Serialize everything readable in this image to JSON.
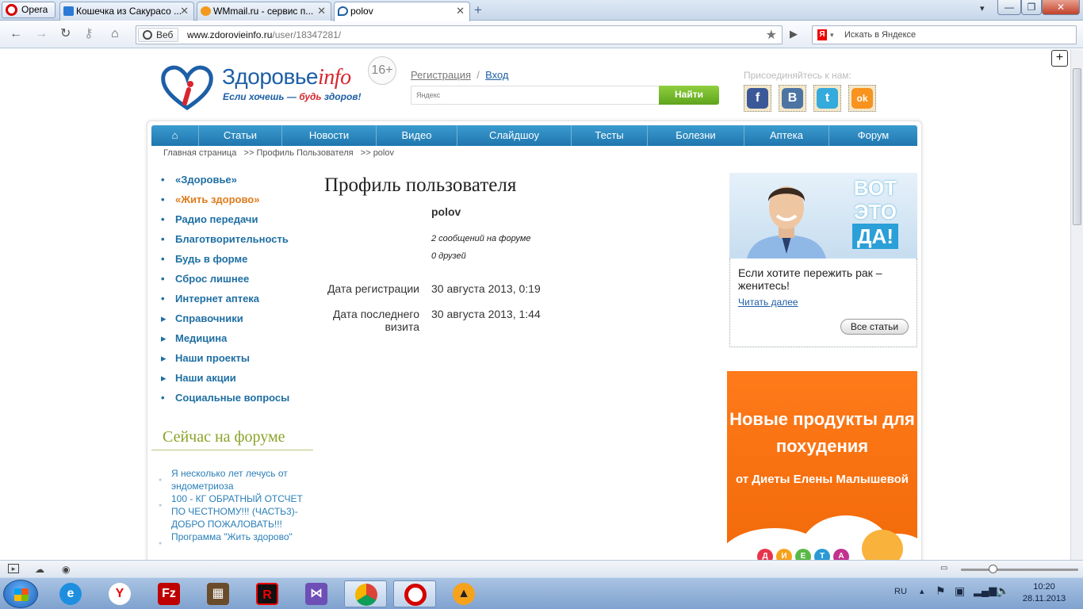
{
  "browser": {
    "menu_label": "Opera",
    "tabs": [
      {
        "title": "Кошечка из Сакурасо ..."
      },
      {
        "title": "WMmail.ru - сервис п..."
      },
      {
        "title": "polov"
      }
    ],
    "web_label": "Веб",
    "url_domain": "www.zdorovieinfo.ru",
    "url_path": "/user/18347281/",
    "search_placeholder": "Искать в Яндексе",
    "search_engine_letter": "Я"
  },
  "site": {
    "logo_main": "Здоровье",
    "logo_accent": "info",
    "slogan_a": "Если хочешь — ",
    "slogan_b": "будь",
    "slogan_c": " здоров!",
    "age": "16+",
    "register": "Регистрация",
    "sep": "/",
    "login": "Вход",
    "search_hint": "Яндекс",
    "search_button": "Найти",
    "join_label": "Присоединяйтесь к нам:",
    "social": [
      {
        "name": "facebook",
        "glyph": "f",
        "color": "#3b5998"
      },
      {
        "name": "vkontakte",
        "glyph": "B",
        "color": "#4c75a3"
      },
      {
        "name": "twitter",
        "glyph": "t",
        "color": "#35aadc"
      },
      {
        "name": "odnoklassniki",
        "glyph": "ok",
        "color": "#f7931e"
      }
    ]
  },
  "menu": {
    "home_glyph": "⌂",
    "items": [
      "Статьи",
      "Новости",
      "Видео",
      "Слайдшоу",
      "Тесты",
      "Болезни",
      "Аптека",
      "Форум"
    ]
  },
  "breadcrumb": {
    "home": "Главная страница",
    "sep": ">>",
    "section": "Профиль Пользователя",
    "current": "polov"
  },
  "leftnav": [
    {
      "label": "«Здоровье»",
      "bullet": "•",
      "orange": false
    },
    {
      "label": "«Жить здорово»",
      "bullet": "•",
      "orange": true
    },
    {
      "label": "Радио передачи",
      "bullet": "•",
      "orange": false
    },
    {
      "label": "Благотворительность",
      "bullet": "•",
      "orange": false
    },
    {
      "label": "Будь в форме",
      "bullet": "•",
      "orange": false
    },
    {
      "label": "Сброс лишнее",
      "bullet": "•",
      "orange": false
    },
    {
      "label": "Интернет аптека",
      "bullet": "•",
      "orange": false
    },
    {
      "label": "Справочники",
      "bullet": "▸",
      "orange": false
    },
    {
      "label": "Медицина",
      "bullet": "▸",
      "orange": false
    },
    {
      "label": "Наши проекты",
      "bullet": "▸",
      "orange": false
    },
    {
      "label": "Наши акции",
      "bullet": "▸",
      "orange": false
    },
    {
      "label": "Социальные вопросы",
      "bullet": "•",
      "orange": false
    }
  ],
  "forum": {
    "title": "Сейчас на форуме",
    "items": [
      "Я несколько лет лечусь от эндометриоза",
      "100 - КГ ОБРАТНЫЙ ОТСЧЕТ ПО ЧЕСТНОМУ!!! (ЧАСТЬ3)-ДОБРО ПОЖАЛОВАТЬ!!!",
      "Программа \"Жить здорово\""
    ]
  },
  "profile": {
    "title": "Профиль пользователя",
    "username": "polov",
    "forum_messages": "2 сообщений на форуме",
    "friends": "0 друзей",
    "reg_label": "Дата регистрации",
    "reg_value": "30 августа 2013, 0:19",
    "visit_label": "Дата последнего визита",
    "visit_value": "30 августа 2013, 1:44"
  },
  "ad1": {
    "word1": "ВОТ",
    "word2": "ЭТО",
    "word3": "ДА!",
    "text": "Если хотите пережить рак – женитесь!",
    "more": "Читать далее",
    "all": "Все статьи"
  },
  "ad2": {
    "headline": "Новые продукты для похудения",
    "sub": "от Диеты Елены Малышевой",
    "diet_letters": [
      "Д",
      "И",
      "Е",
      "Т",
      "А"
    ],
    "diet_colors": [
      "#e8334a",
      "#f7a21b",
      "#59b947",
      "#2a9ad6",
      "#c2338e"
    ]
  },
  "taskbar": {
    "lang": "RU",
    "time": "10:20",
    "date": "28.11.2013"
  }
}
